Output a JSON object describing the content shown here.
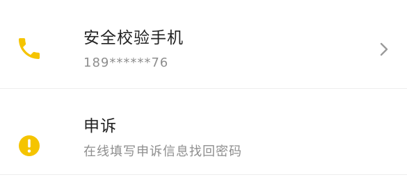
{
  "colors": {
    "accent": "#f5c400",
    "title": "#222222",
    "subtitle": "#8e8e8e",
    "divider": "#eeeeee",
    "chevron": "#9a9a9a"
  },
  "items": [
    {
      "icon": "phone-icon",
      "title": "安全校验手机",
      "subtitle": "189******76",
      "trailing_icon": "chevron-right-icon"
    },
    {
      "icon": "exclamation-circle-icon",
      "title": "申诉",
      "subtitle": "在线填写申诉信息找回密码"
    }
  ]
}
